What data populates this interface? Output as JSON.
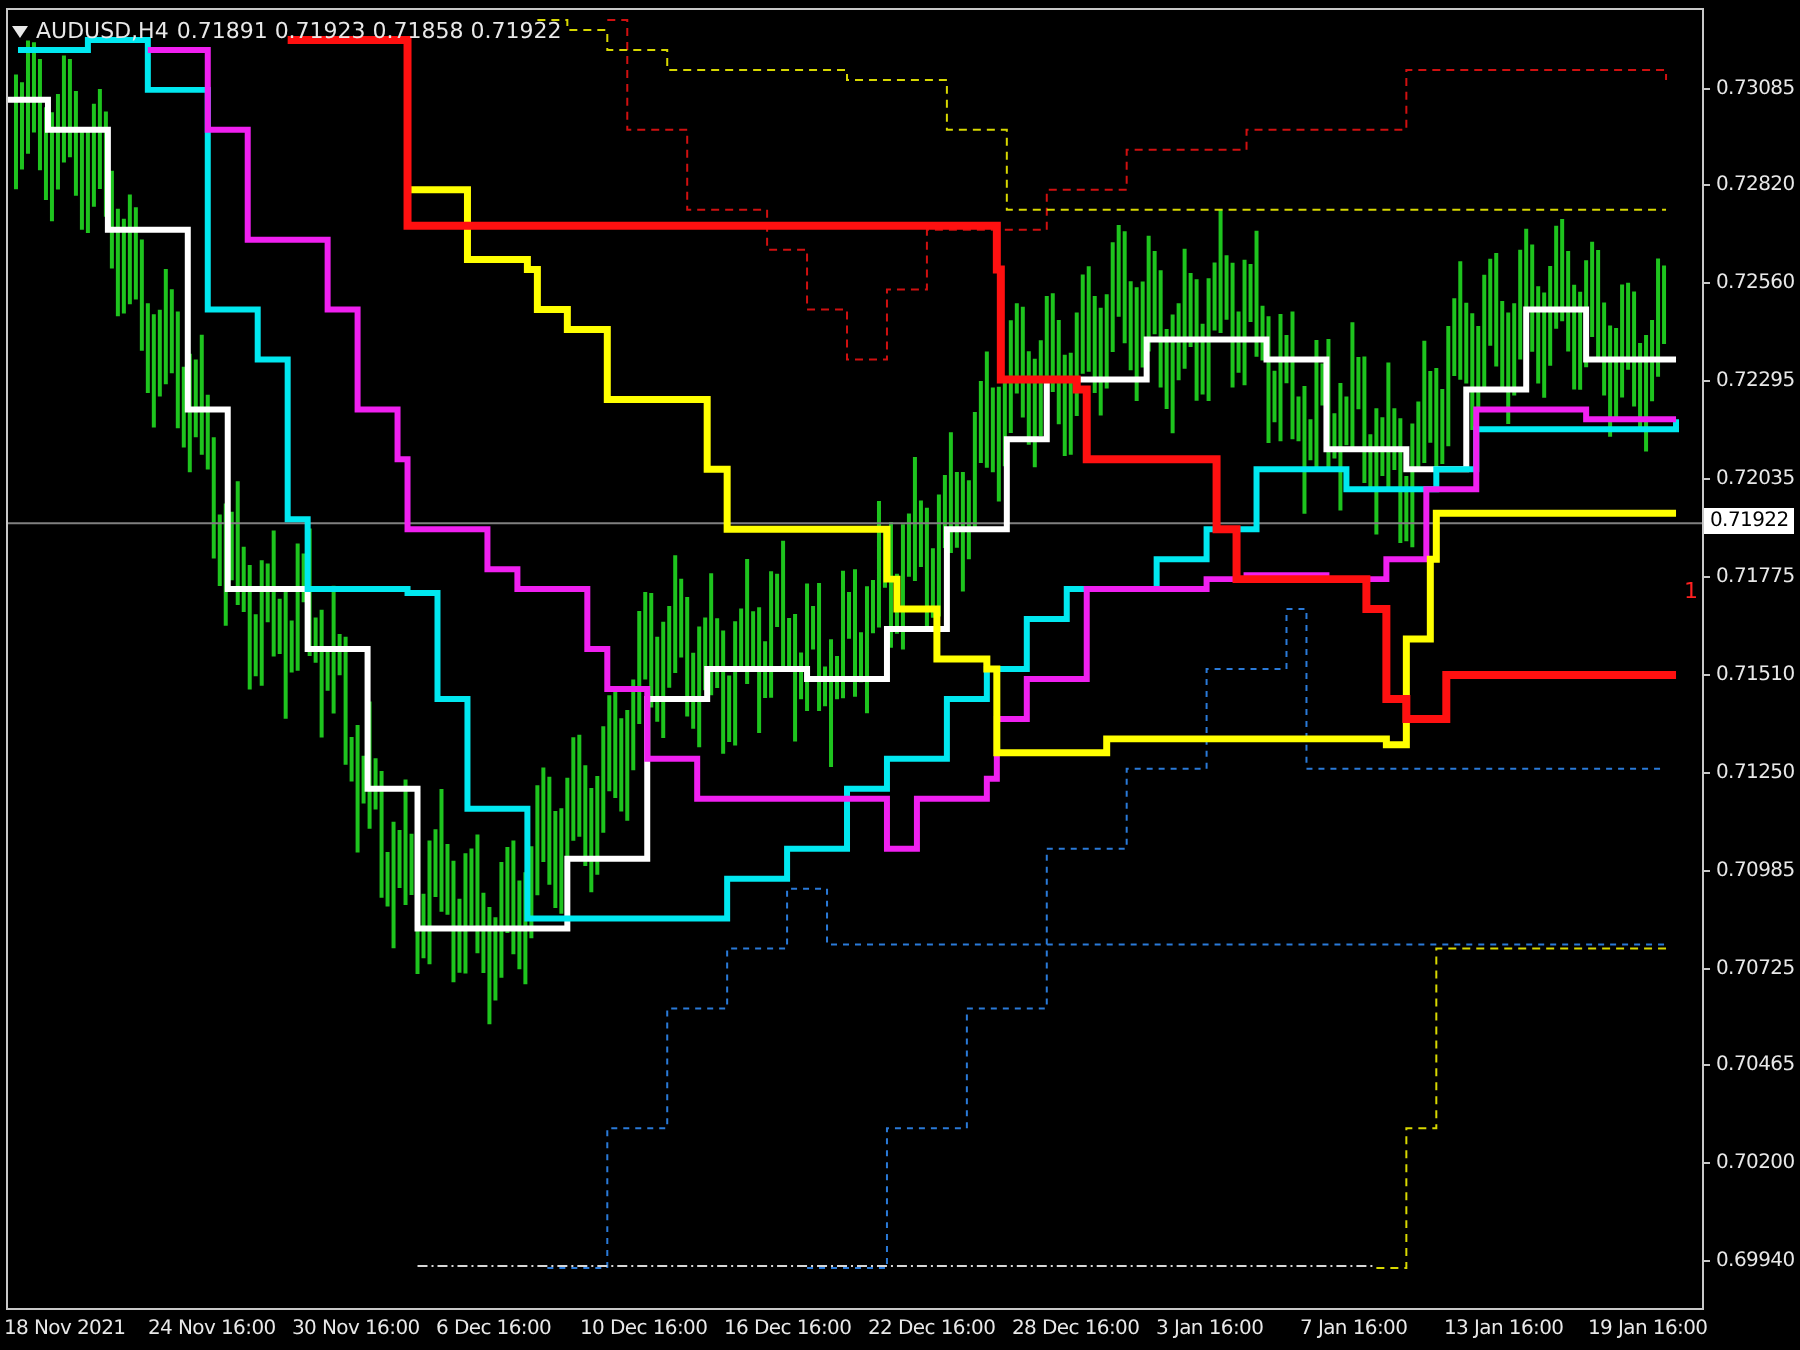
{
  "chart": {
    "symbol": "AUDUSD,H4",
    "ohlc": "0.71891 0.71923 0.71858 0.71922",
    "marker": "1"
  },
  "price_axis": [
    "0.73085",
    "0.72820",
    "0.72560",
    "0.72295",
    "0.72035",
    "0.71775",
    "0.71510",
    "0.71250",
    "0.70985",
    "0.70725",
    "0.70465",
    "0.70200",
    "0.69940"
  ],
  "current_price": "0.71922",
  "time_axis": [
    "18 Nov 2021",
    "24 Nov 16:00",
    "30 Nov 16:00",
    "6 Dec 16:00",
    "10 Dec 16:00",
    "16 Dec 16:00",
    "22 Dec 16:00",
    "28 Dec 16:00",
    "3 Jan 16:00",
    "7 Jan 16:00",
    "13 Jan 16:00",
    "19 Jan 16:00"
  ]
}
